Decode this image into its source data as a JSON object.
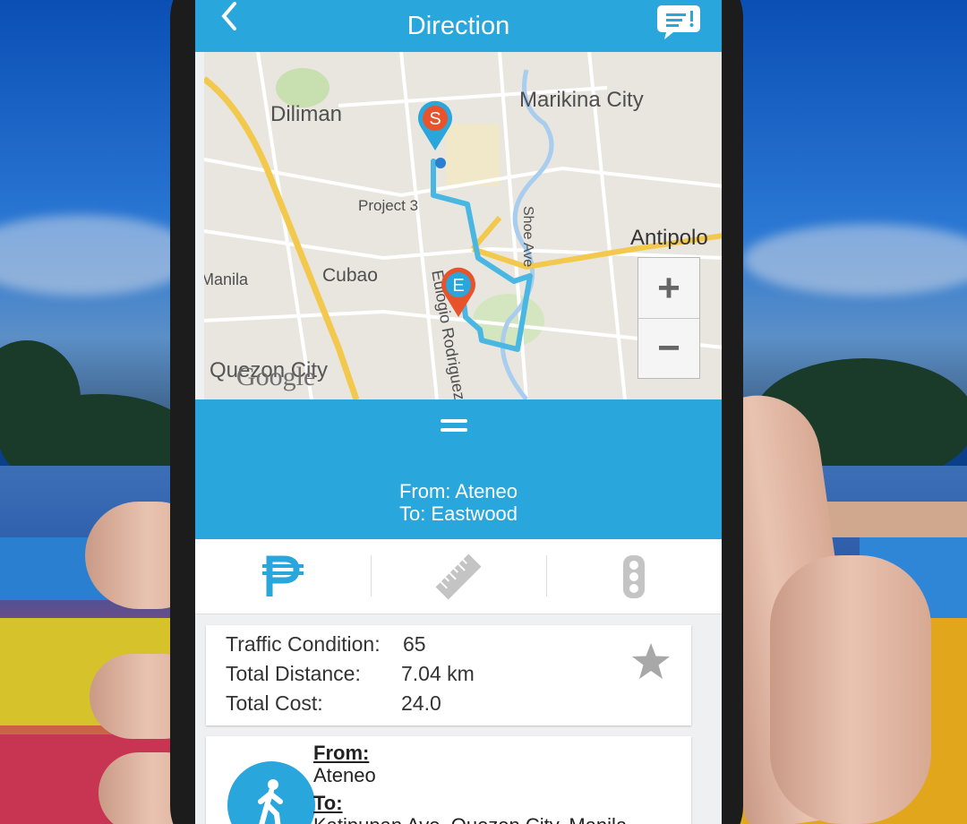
{
  "header": {
    "title": "Direction",
    "back_icon": "chevron-left-icon",
    "chat_icon": "chat-bubble-icon"
  },
  "map": {
    "labels": {
      "diliman": "Diliman",
      "marikina": "Marikina City",
      "project3": "Project 3",
      "shoe_ave": "Shoe Ave",
      "antipolo": "Antipolo",
      "manila": "Manila",
      "cubao": "Cubao",
      "eulogio": "Eulogio Rodriguez Jr",
      "quezon": "Quezon City",
      "google": "Google"
    },
    "start_marker": "S",
    "end_marker": "E",
    "zoom_in": "+",
    "zoom_out": "−"
  },
  "route": {
    "from": "From: Ateneo",
    "to": "To: Eastwood"
  },
  "tabs": [
    {
      "name": "fare",
      "icon": "peso-icon",
      "color": "#29a6dc",
      "active": true
    },
    {
      "name": "distance",
      "icon": "ruler-icon",
      "active": false
    },
    {
      "name": "traffic",
      "icon": "traffic-light-icon",
      "active": false
    }
  ],
  "summary": {
    "traffic_label": "Traffic Condition:",
    "traffic_value": "65",
    "distance_label": "Total Distance:",
    "distance_value": "7.04 km",
    "cost_label": "Total Cost:",
    "cost_value": "24.0"
  },
  "step": {
    "icon": "walking-person-icon",
    "from_label": "From:",
    "from_value": "Ateneo",
    "to_label": "To:",
    "to_value": "Katipunan Ave, Quezon City, Manila"
  },
  "colors": {
    "accent": "#29a6dc",
    "start_marker": "#e8532b",
    "end_marker": "#e8532b",
    "route_line": "#4ab7e3"
  }
}
